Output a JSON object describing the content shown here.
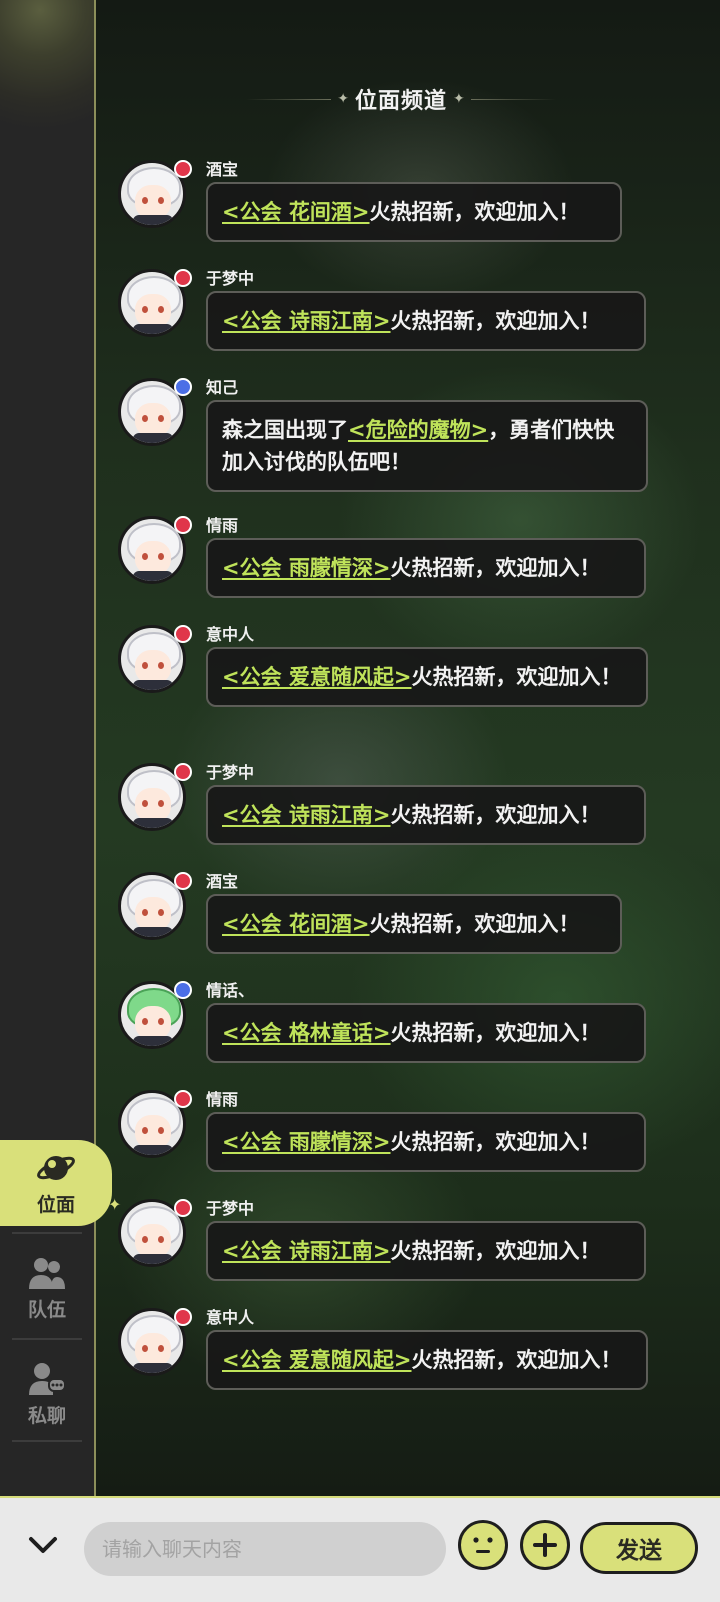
{
  "channel": {
    "title": "位面频道"
  },
  "sidebar": {
    "tabs": [
      {
        "label": "位面",
        "icon": "planet-icon",
        "active": true
      },
      {
        "label": "队伍",
        "icon": "team-icon",
        "active": false
      },
      {
        "label": "私聊",
        "icon": "private-chat-icon",
        "active": false
      }
    ]
  },
  "messages": [
    {
      "name": "酒宝",
      "badge": "red",
      "avatar": "white-hair",
      "link": "<公会 花间酒>",
      "text": "火热招新，欢迎加入！"
    },
    {
      "name": "于梦中",
      "badge": "red",
      "avatar": "white-hair",
      "link": "<公会 诗雨江南>",
      "text": "火热招新，欢迎加入！"
    },
    {
      "name": "知己",
      "badge": "blue",
      "avatar": "white-hair",
      "prefix": "森之国出现了",
      "link": "<危险的魔物>",
      "text": "，勇者们快快加入讨伐的队伍吧！"
    },
    {
      "name": "情雨",
      "badge": "red",
      "avatar": "white-hair",
      "link": "<公会 雨朦情深>",
      "text": "火热招新，欢迎加入！"
    },
    {
      "name": "意中人",
      "badge": "red",
      "avatar": "white-hair",
      "link": "<公会 爱意随风起>",
      "text": "火热招新，欢迎加入！"
    },
    {
      "name": "于梦中",
      "badge": "red",
      "avatar": "white-hair",
      "link": "<公会 诗雨江南>",
      "text": "火热招新，欢迎加入！"
    },
    {
      "name": "酒宝",
      "badge": "red",
      "avatar": "white-hair",
      "link": "<公会 花间酒>",
      "text": "火热招新，欢迎加入！"
    },
    {
      "name": "情话、",
      "badge": "blue",
      "avatar": "green-hair",
      "link": "<公会 格林童话>",
      "text": "火热招新，欢迎加入！"
    },
    {
      "name": "情雨",
      "badge": "red",
      "avatar": "white-hair",
      "link": "<公会 雨朦情深>",
      "text": "火热招新，欢迎加入！"
    },
    {
      "name": "于梦中",
      "badge": "red",
      "avatar": "white-hair",
      "link": "<公会 诗雨江南>",
      "text": "火热招新，欢迎加入！"
    },
    {
      "name": "意中人",
      "badge": "red",
      "avatar": "white-hair",
      "link": "<公会 爱意随风起>",
      "text": "火热招新，欢迎加入！"
    }
  ],
  "input": {
    "placeholder": "请输入聊天内容",
    "value": ""
  },
  "buttons": {
    "send_label": "发送",
    "emoji_icon": "emoji-icon",
    "plus_icon": "plus-icon",
    "collapse_icon": "chevron-down-icon"
  },
  "colors": {
    "accent": "#d9e07a",
    "link": "#bfe35a",
    "badge_red": "#e0364a",
    "badge_blue": "#4b6fe6"
  }
}
